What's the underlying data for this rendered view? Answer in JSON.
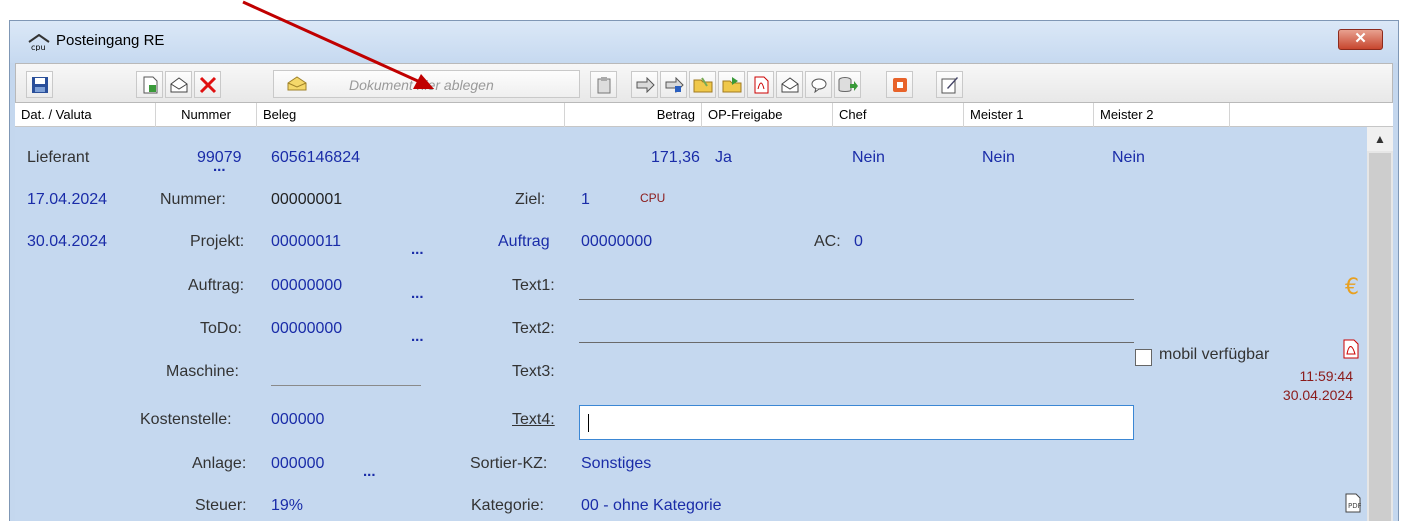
{
  "window": {
    "title": "Posteingang RE",
    "close_label": "✕"
  },
  "toolbar": {
    "drop_zone_text": "Dokument hier ablegen",
    "icons": [
      "save-icon",
      "new-document-icon",
      "mail-open-icon",
      "delete-icon",
      "envelope-icon",
      "clipboard-icon",
      "forward-icon",
      "forward-multiple-icon",
      "folder-open-icon",
      "folder-export-icon",
      "pdf-icon",
      "mail-icon",
      "comment-icon",
      "database-export-icon",
      "office-icon",
      "edit-note-icon"
    ]
  },
  "columns": [
    "Dat. / Valuta",
    "Nummer",
    "Beleg",
    "Betrag",
    "OP-Freigabe",
    "Chef",
    "Meister 1",
    "Meister 2"
  ],
  "row": {
    "lieferant_label": "Lieferant",
    "nummer": "99079",
    "beleg": "6056146824",
    "betrag": "171,36",
    "op_freigabe": "Ja",
    "chef": "Nein",
    "meister1": "Nein",
    "meister2": "Nein"
  },
  "details": {
    "date1": "17.04.2024",
    "date2": "30.04.2024",
    "nummer_label": "Nummer:",
    "nummer_value": "00000001",
    "ziel_label": "Ziel:",
    "ziel_value": "1",
    "cpu_text": "CPU",
    "projekt_label": "Projekt:",
    "projekt_value": "00000011",
    "auftrag_link": "Auftrag",
    "auftrag_link_value": "00000000",
    "ac_label": "AC:",
    "ac_value": "0",
    "auftrag_label": "Auftrag:",
    "auftrag_value": "00000000",
    "text1_label": "Text1:",
    "todo_label": "ToDo:",
    "todo_value": "00000000",
    "text2_label": "Text2:",
    "maschine_label": "Maschine:",
    "text3_label": "Text3:",
    "kostenstelle_label": "Kostenstelle:",
    "kostenstelle_value": "000000",
    "text4_label": "Text4:",
    "text4_value": "",
    "anlage_label": "Anlage:",
    "anlage_value": "000000",
    "sortier_label": "Sortier-KZ:",
    "sortier_value": "Sonstiges",
    "steuer_label": "Steuer:",
    "steuer_value": "19%",
    "kategorie_label": "Kategorie:",
    "kategorie_value": "00 - ohne Kategorie",
    "mobil_label": "mobil verfügbar",
    "time": "11:59:44",
    "date": "30.04.2024",
    "ellipsis": "..."
  },
  "colors": {
    "link": "#1a2ca8",
    "accent_red": "#c00000",
    "content_bg": "#c5d8ef"
  }
}
